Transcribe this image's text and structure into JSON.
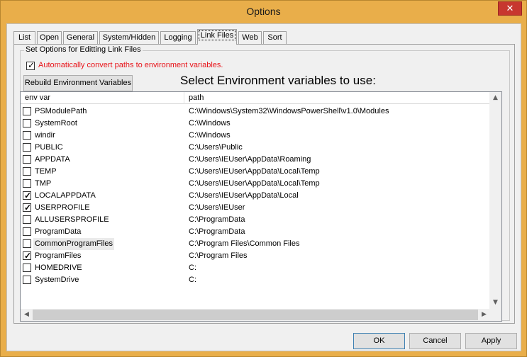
{
  "window": {
    "title": "Options",
    "close_label": "✕"
  },
  "tabs": [
    {
      "label": "List"
    },
    {
      "label": "Open"
    },
    {
      "label": "General"
    },
    {
      "label": "System/Hidden"
    },
    {
      "label": "Logging"
    },
    {
      "label": "Link Files"
    },
    {
      "label": "Web"
    },
    {
      "label": "Sort"
    }
  ],
  "active_tab": "Link Files",
  "group": {
    "label": "Set Options for Editting Link Files",
    "auto_convert": {
      "label": "Automatically convert paths to environment variables.",
      "checked": true
    },
    "rebuild_button": "Rebuild Environment Variables",
    "heading": "Select Environment variables to use:"
  },
  "table": {
    "columns": [
      "env var",
      "path"
    ],
    "rows": [
      {
        "var": "PSModulePath",
        "path": "C:\\Windows\\System32\\WindowsPowerShell\\v1.0\\Modules",
        "checked": false
      },
      {
        "var": "SystemRoot",
        "path": "C:\\Windows",
        "checked": false
      },
      {
        "var": "windir",
        "path": "C:\\Windows",
        "checked": false
      },
      {
        "var": "PUBLIC",
        "path": "C:\\Users\\Public",
        "checked": false
      },
      {
        "var": "APPDATA",
        "path": "C:\\Users\\IEUser\\AppData\\Roaming",
        "checked": false
      },
      {
        "var": "TEMP",
        "path": "C:\\Users\\IEUser\\AppData\\Local\\Temp",
        "checked": false
      },
      {
        "var": "TMP",
        "path": "C:\\Users\\IEUser\\AppData\\Local\\Temp",
        "checked": false
      },
      {
        "var": "LOCALAPPDATA",
        "path": "C:\\Users\\IEUser\\AppData\\Local",
        "checked": true
      },
      {
        "var": "USERPROFILE",
        "path": "C:\\Users\\IEUser",
        "checked": true
      },
      {
        "var": "ALLUSERSPROFILE",
        "path": "C:\\ProgramData",
        "checked": false
      },
      {
        "var": "ProgramData",
        "path": "C:\\ProgramData",
        "checked": false
      },
      {
        "var": "CommonProgramFiles",
        "path": "C:\\Program Files\\Common Files",
        "checked": false
      },
      {
        "var": "ProgramFiles",
        "path": "C:\\Program Files",
        "checked": true
      },
      {
        "var": "HOMEDRIVE",
        "path": "C:",
        "checked": false
      },
      {
        "var": "SystemDrive",
        "path": "C:",
        "checked": false
      }
    ],
    "focused_row": "CommonProgramFiles"
  },
  "buttons": {
    "ok": "OK",
    "cancel": "Cancel",
    "apply": "Apply"
  },
  "colors": {
    "titlebar": "#e9ae4a",
    "close": "#c7372f",
    "warning_text": "#e8141a"
  }
}
